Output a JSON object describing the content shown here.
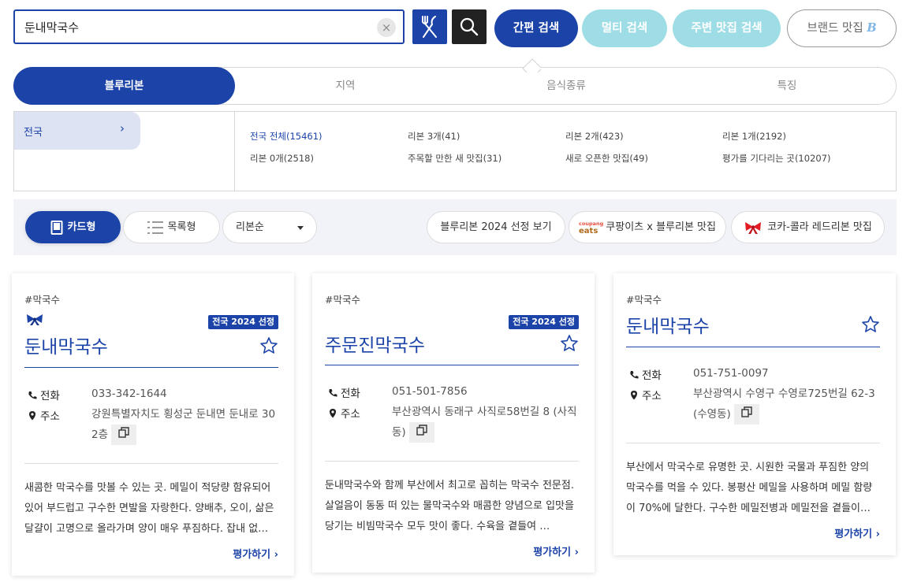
{
  "search": {
    "value": "둔내막국수",
    "clear_icon": "×"
  },
  "buttons": {
    "simple_search": "간편 검색",
    "multi_search": "멀티 검색",
    "nearby_search": "주변 맛집 검색",
    "brand_search": "브랜드 맛집",
    "brand_mark": "B"
  },
  "tabs": [
    "블루리본",
    "지역",
    "음식종류",
    "특징"
  ],
  "region": {
    "label": "전국",
    "arrow": "›"
  },
  "filters": [
    "전국 전체(15461)",
    "리본 3개(41)",
    "리본 2개(423)",
    "리본 1개(2192)",
    "리본 0개(2518)",
    "주목할 만한 새 맛집(31)",
    "새로 오픈한 맛집(49)",
    "평가를 기다리는 곳(10207)"
  ],
  "toolbar": {
    "card_view": "카드형",
    "list_view": "목록형",
    "sort": "리본순",
    "y2024": "블루리본 2024 선정 보기",
    "eats_logo_top": "coupang",
    "eats_logo_bottom": "eats",
    "eats": "쿠팡이츠 x 블루리본 맛집",
    "coke": "코카-콜라 레드리본 맛집"
  },
  "colors": {
    "primary": "#1c44a8",
    "light_pill": "#9fdde6",
    "toolbar_bg": "#f1f3f8"
  },
  "cards": [
    {
      "tag": "#막국수",
      "badge": "전국 2024 선정",
      "title": "둔내막국수",
      "phone_label": "전화",
      "phone": "033-342-1644",
      "address_label": "주소",
      "address": "강원특별자치도 횡성군 둔내면 둔내로 30 2층",
      "desc": "새콤한 막국수를 맛볼 수 있는 곳. 메밀이 적당량 함유되어 있어 부드럽고 구수한 면발을 자랑한다. 양배추, 오이, 삶은 달걀이 고명으로 올라가며 양이 매우 푸짐하다. 잡내 없…",
      "rate": "평가하기"
    },
    {
      "tag": "#막국수",
      "badge": "전국 2024 선정",
      "title": "주문진막국수",
      "phone_label": "전화",
      "phone": "051-501-7856",
      "address_label": "주소",
      "address": "부산광역시 동래구 사직로58번길 8 (사직동)",
      "desc": "둔내막국수와 함께 부산에서 최고로 꼽히는 막국수 전문점. 살얼음이 동동 떠 있는 물막국수와 매콤한 양념으로 입맛을 당기는 비빔막국수 모두 맛이 좋다. 수육을 곁들여 …",
      "rate": "평가하기"
    },
    {
      "tag": "#막국수",
      "title": "둔내막국수",
      "phone_label": "전화",
      "phone": "051-751-0097",
      "address_label": "주소",
      "address": "부산광역시 수영구 수영로725번길 62-3 (수영동)",
      "desc": "부산에서 막국수로 유명한 곳. 시원한 국물과 푸짐한 양의 막국수를 먹을 수 있다. 봉평산 메밀을 사용하며 메밀 함량이 70%에 달한다. 구수한 메밀전병과 메밀전을 곁들이…",
      "rate": "평가하기"
    }
  ]
}
